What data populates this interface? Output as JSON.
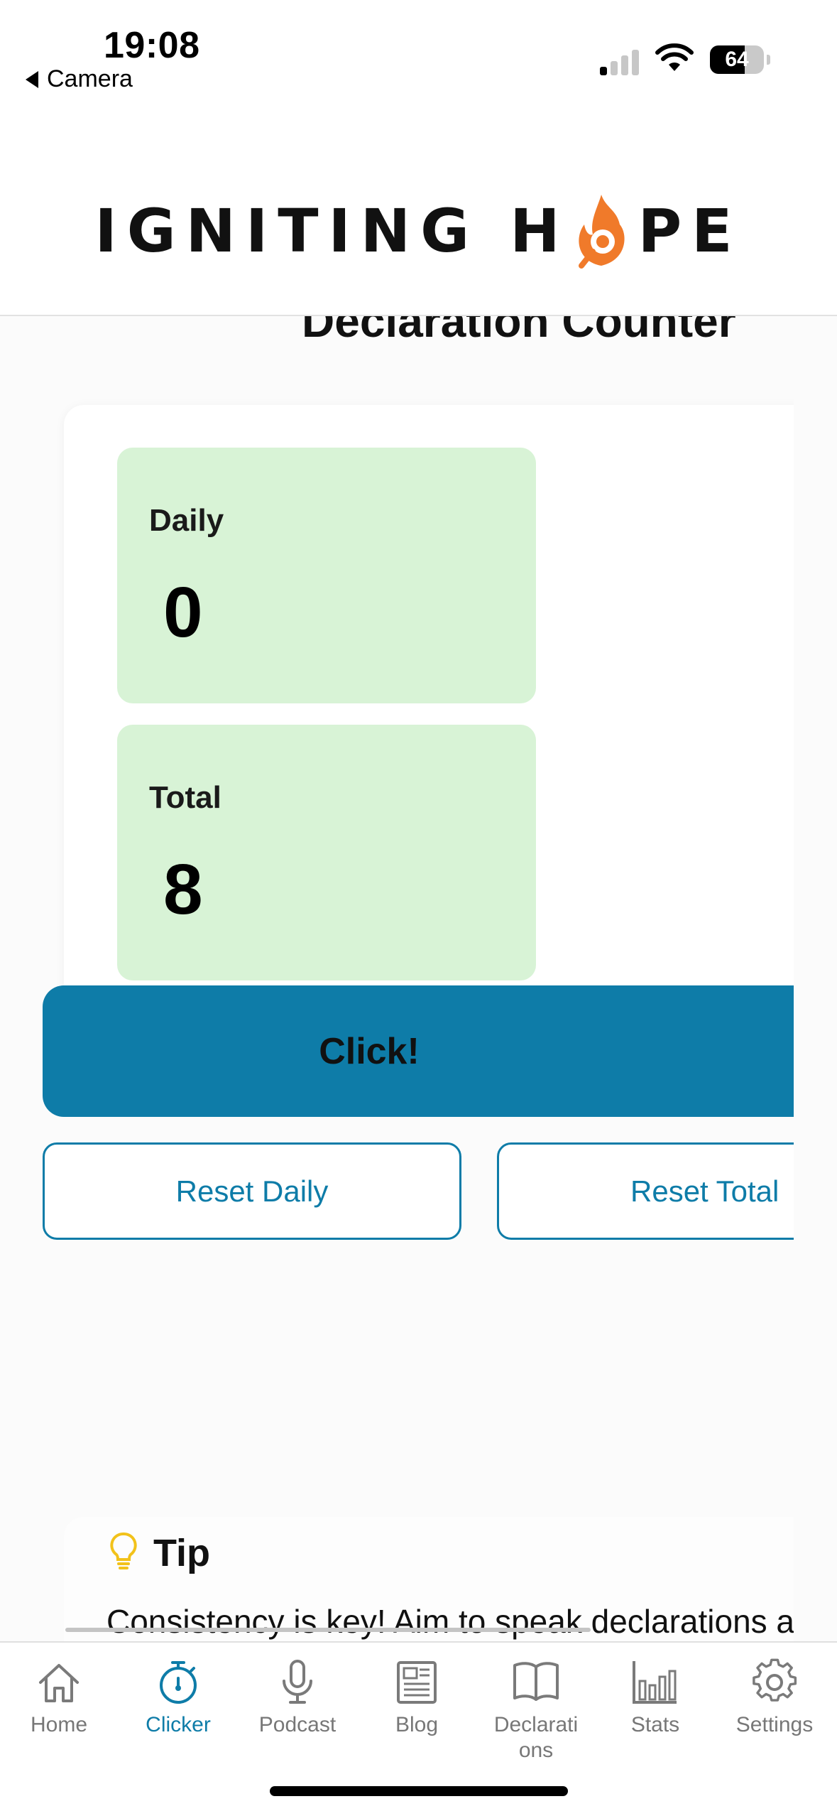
{
  "status": {
    "time": "19:08",
    "back_label": "Camera",
    "battery": "64",
    "battery_level": 0.64
  },
  "header": {
    "logo_left": "IGNITING H",
    "logo_right": "PE",
    "logo_icon": "flame-o-icon"
  },
  "page": {
    "peek_title": "Declaration Counter"
  },
  "counter": {
    "daily_label": "Daily",
    "daily_value": "0",
    "total_label": "Total",
    "total_value": "8",
    "click_label": "Click!",
    "reset_daily_label": "Reset Daily",
    "reset_total_label": "Reset Total"
  },
  "tip": {
    "icon": "lightbulb-icon",
    "title": "Tip",
    "text": "Consistency is key! Aim to speak declarations a"
  },
  "tabs": [
    {
      "label": "Home",
      "icon": "home-icon"
    },
    {
      "label": "Clicker",
      "icon": "stopwatch-icon"
    },
    {
      "label": "Podcast",
      "icon": "microphone-icon"
    },
    {
      "label": "Blog",
      "icon": "newspaper-icon"
    },
    {
      "label": "Declarati\nons",
      "icon": "book-icon"
    },
    {
      "label": "Stats",
      "icon": "bar-chart-icon"
    },
    {
      "label": "Settings",
      "icon": "gear-icon"
    }
  ],
  "colors": {
    "accent": "#0e7ca8",
    "stat_bg": "#d8f3d6",
    "flame": "#f07a2a",
    "tip_icon": "#f2c21a"
  }
}
